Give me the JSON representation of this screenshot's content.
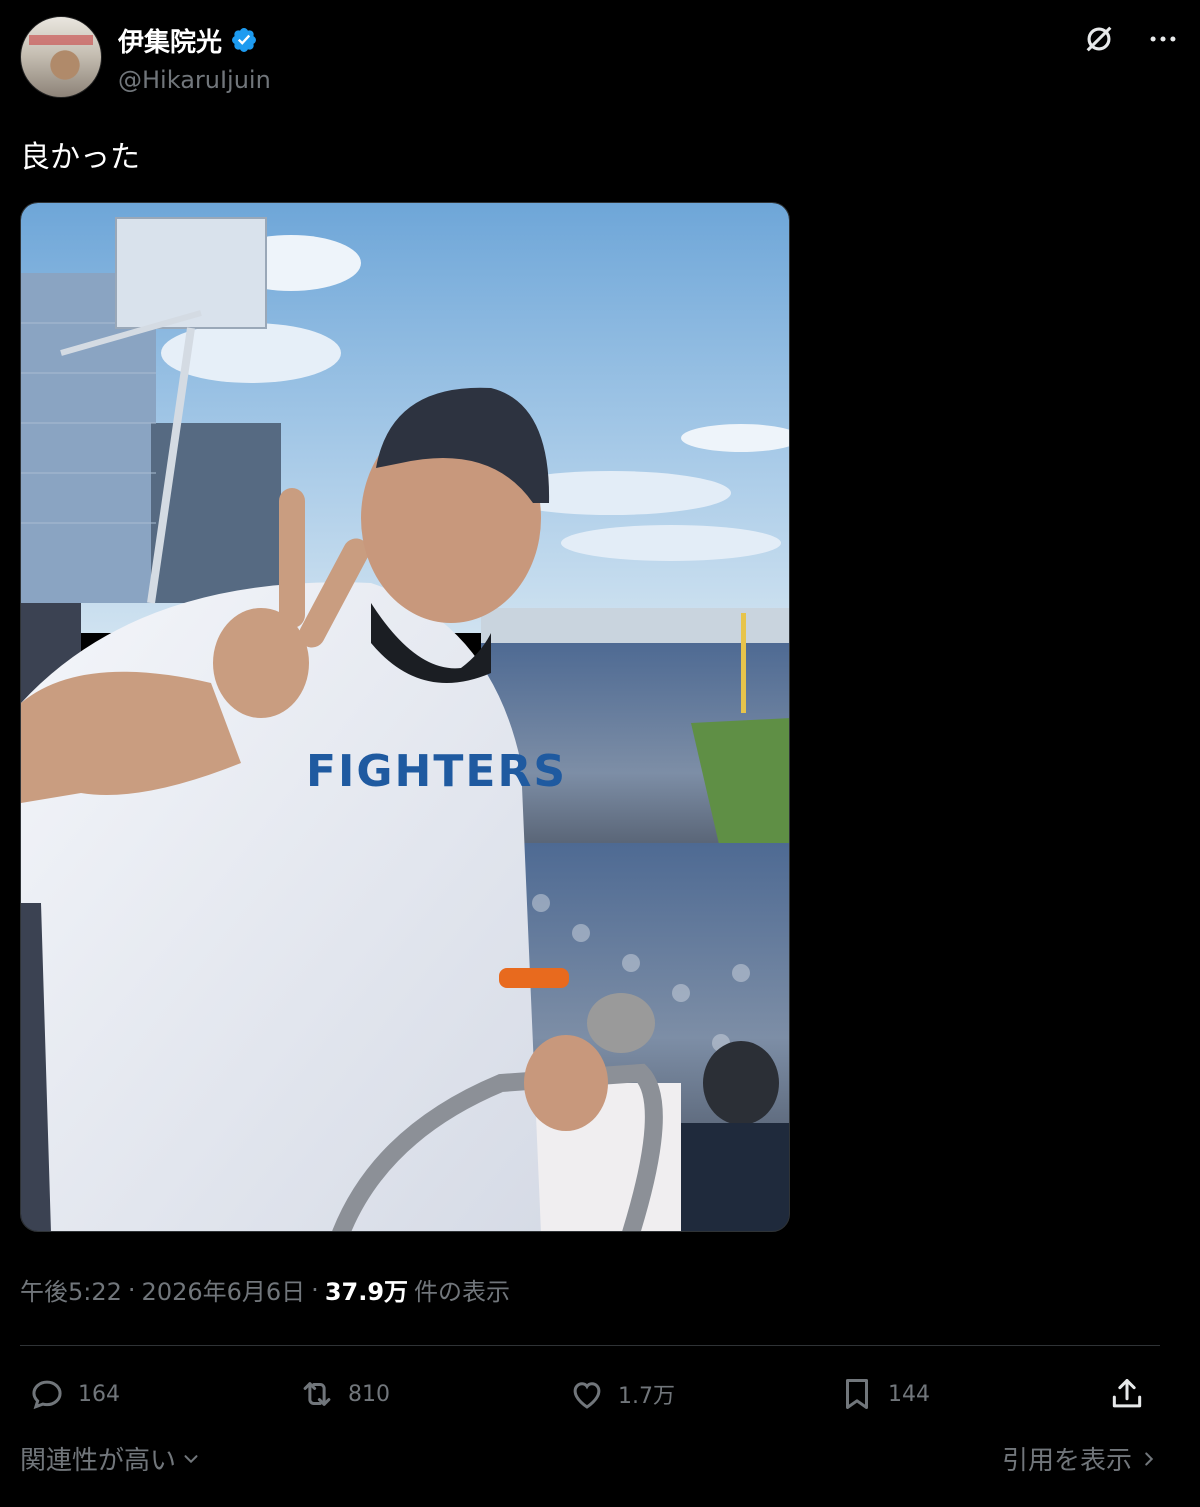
{
  "header": {
    "display_name": "伊集院光",
    "handle": "@HikaruIjuin",
    "icons": [
      "avatar",
      "verified-badge-icon",
      "grok-icon",
      "more-icon"
    ]
  },
  "tweet": {
    "text": "良かった",
    "image": {
      "alt": "",
      "jersey_text": "FIGHTERS"
    }
  },
  "meta": {
    "time": "午後5:22",
    "sep1": "·",
    "date": "2026年6月6日",
    "sep2": "·",
    "views": "37.9万",
    "views_suffix": "件の表示"
  },
  "actions": {
    "replies": "164",
    "reposts": "810",
    "likes": "1.7万",
    "bookmarks": "144"
  },
  "footer": {
    "sort_label": "関連性が高い",
    "quotes_label": "引用を表示"
  },
  "colors": {
    "background": "#000000",
    "verified": "#1d9bf0",
    "secondary_text": "#71767b"
  }
}
